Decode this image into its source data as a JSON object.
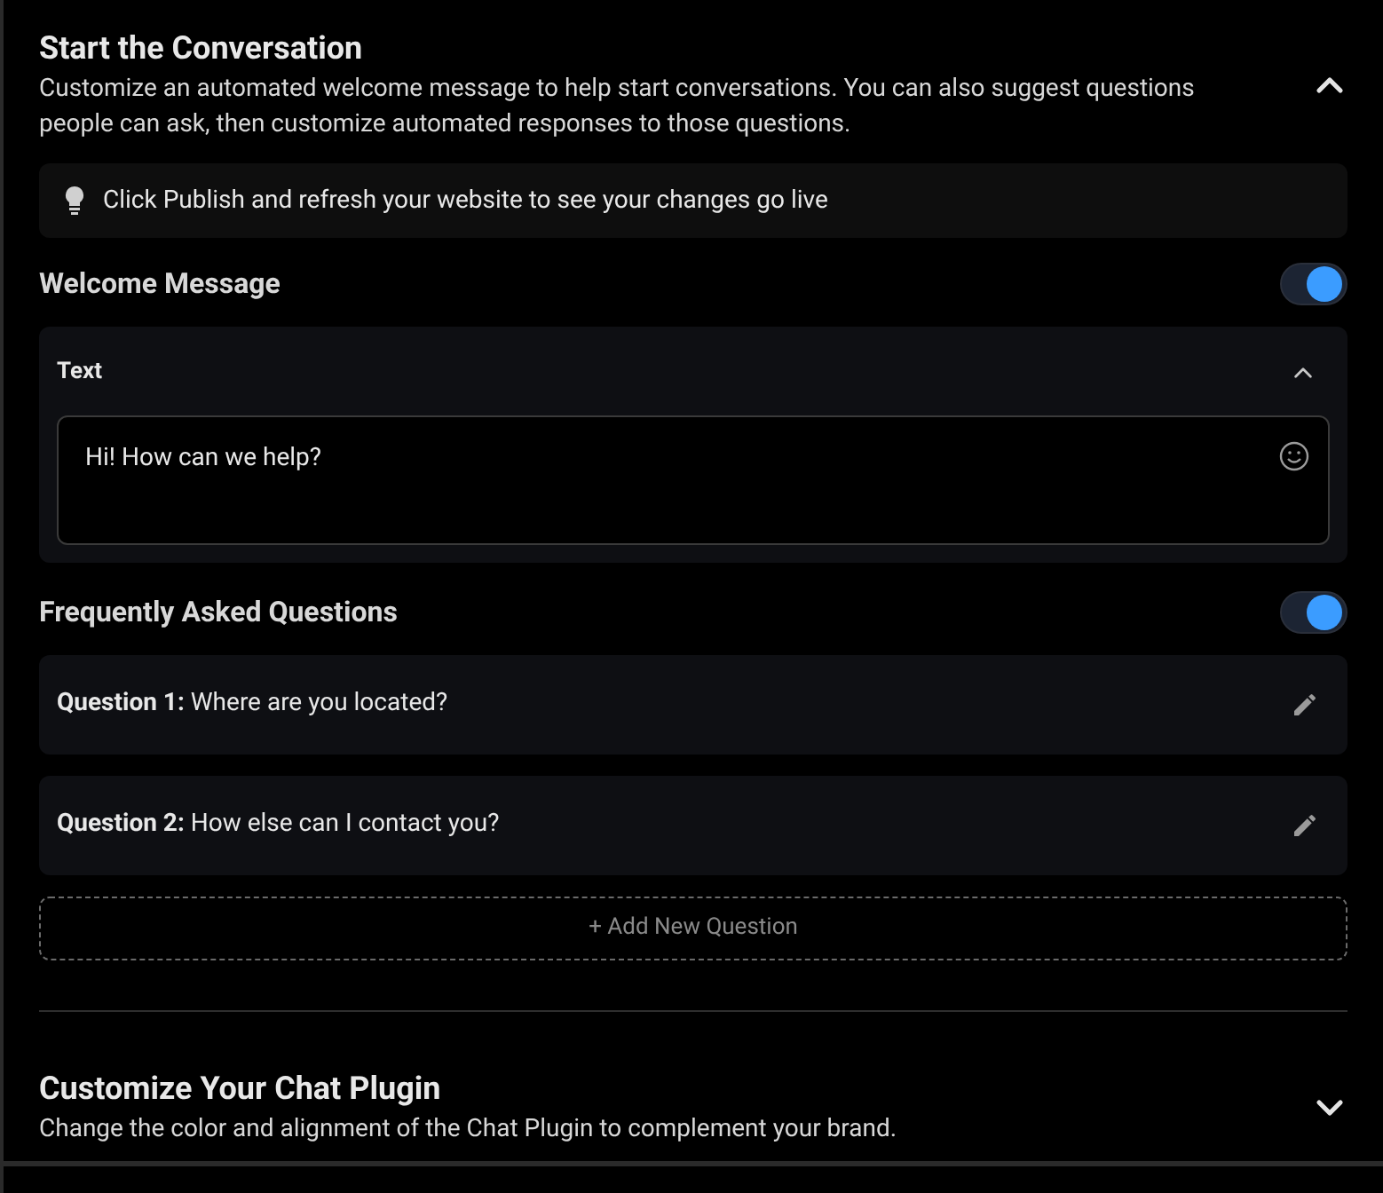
{
  "sections": [
    {
      "title": "Start the Conversation",
      "description": "Customize an automated welcome message to help start conversations. You can also suggest questions people can ask, then customize automated responses to those questions.",
      "expanded": true
    },
    {
      "title": "Customize Your Chat Plugin",
      "description": "Change the color and alignment of the Chat Plugin to complement your brand.",
      "expanded": false
    }
  ],
  "tip": "Click Publish and refresh your website to see your changes go live",
  "welcome": {
    "title": "Welcome Message",
    "on": true,
    "panel": {
      "title": "Text",
      "expanded": true,
      "value": "Hi! How can we help?"
    }
  },
  "faq": {
    "title": "Frequently Asked Questions",
    "on": true,
    "questions": [
      {
        "label": "Question 1:",
        "text": "Where are you located?"
      },
      {
        "label": "Question 2:",
        "text": "How else can I contact you?"
      }
    ],
    "add_button": "+ Add New Question"
  }
}
